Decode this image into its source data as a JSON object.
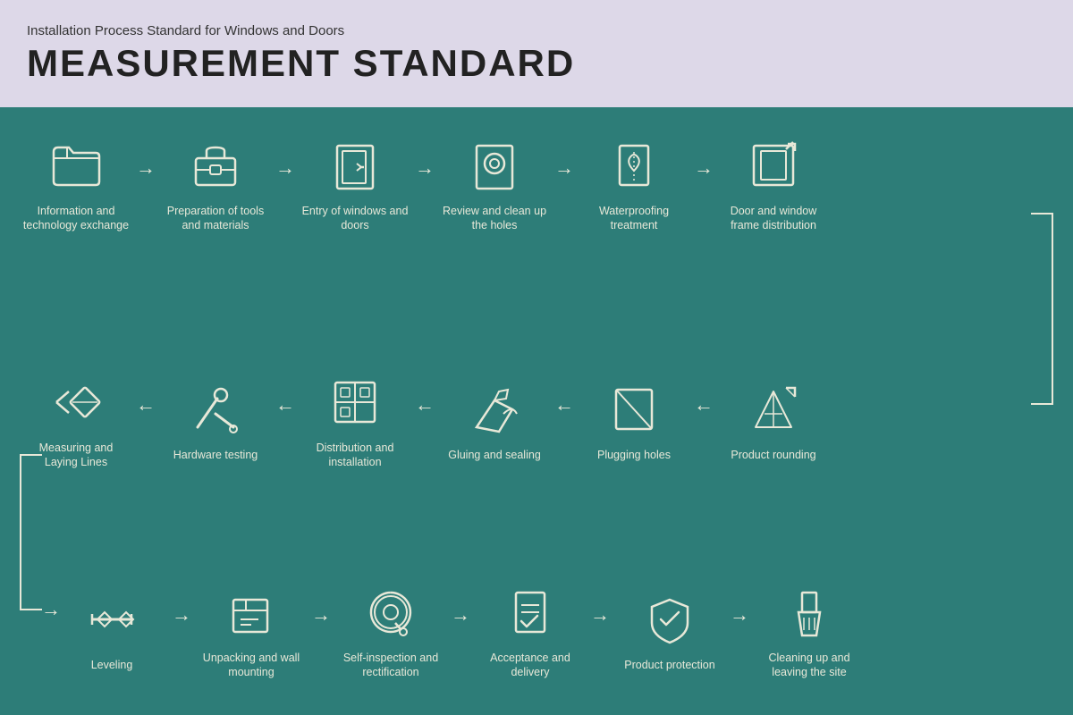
{
  "header": {
    "subtitle": "Installation Process Standard for Windows and Doors",
    "title": "MEASUREMENT STANDARD"
  },
  "row1": [
    {
      "id": "info-tech",
      "label": "Information and technology exchange",
      "icon": "folder"
    },
    {
      "id": "prep-tools",
      "label": "Preparation of tools and materials",
      "icon": "toolbox"
    },
    {
      "id": "entry-windows",
      "label": "Entry of windows and doors",
      "icon": "door-entry"
    },
    {
      "id": "review-holes",
      "label": "Review and clean up the holes",
      "icon": "magnify"
    },
    {
      "id": "waterproofing",
      "label": "Waterproofing treatment",
      "icon": "waterproof"
    },
    {
      "id": "frame-dist",
      "label": "Door and window frame distribution",
      "icon": "frame-dist"
    }
  ],
  "row2": [
    {
      "id": "measure-lines",
      "label": "Measuring and Laying Lines",
      "icon": "measure"
    },
    {
      "id": "hardware-test",
      "label": "Hardware testing",
      "icon": "hardware"
    },
    {
      "id": "dist-install",
      "label": "Distribution and installation",
      "icon": "dist-install"
    },
    {
      "id": "gluing",
      "label": "Gluing and sealing",
      "icon": "glue"
    },
    {
      "id": "plugging",
      "label": "Plugging holes",
      "icon": "plug"
    },
    {
      "id": "rounding",
      "label": "Product rounding",
      "icon": "round"
    }
  ],
  "row3": [
    {
      "id": "leveling",
      "label": "Leveling",
      "icon": "level"
    },
    {
      "id": "unpacking",
      "label": "Unpacking and wall mounting",
      "icon": "unpack"
    },
    {
      "id": "self-inspect",
      "label": "Self-inspection and rectification",
      "icon": "self-inspect"
    },
    {
      "id": "acceptance",
      "label": "Acceptance and delivery",
      "icon": "accept"
    },
    {
      "id": "product-protect",
      "label": "Product protection",
      "icon": "protect"
    },
    {
      "id": "cleanup",
      "label": "Cleaning up and leaving the site",
      "icon": "cleanup"
    }
  ]
}
